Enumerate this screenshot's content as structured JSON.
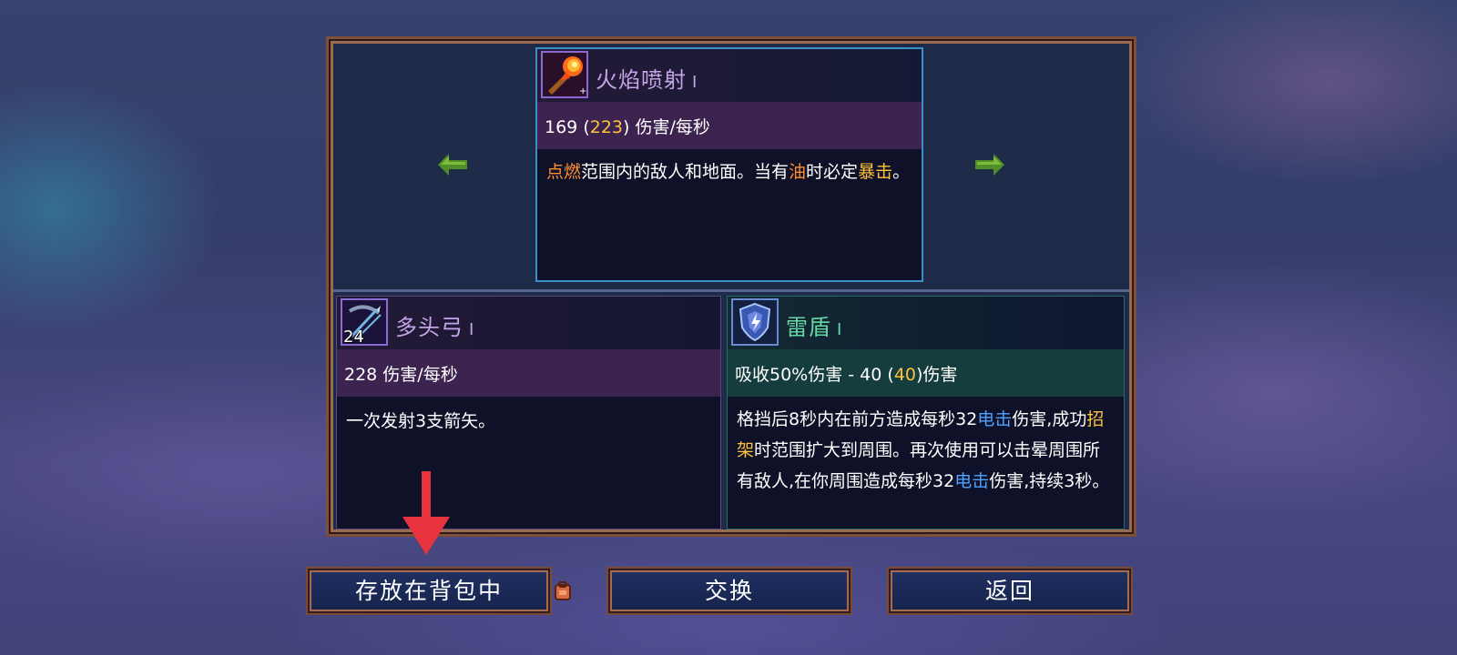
{
  "weapon_top": {
    "name": "火焰喷射",
    "level": "I",
    "stat": {
      "base": "169",
      "open": "(",
      "bonus": "223",
      "close": ")",
      "unit": "伤害/每秒"
    },
    "desc": [
      {
        "t": "点燃",
        "c": "orange"
      },
      {
        "t": "范围内的敌人和地面。当有",
        "c": ""
      },
      {
        "t": "油",
        "c": "orange"
      },
      {
        "t": "时必定",
        "c": ""
      },
      {
        "t": "暴击",
        "c": "gold"
      },
      {
        "t": "。",
        "c": ""
      }
    ],
    "icon": "flamethrower-icon"
  },
  "weapon_left": {
    "name": "多头弓",
    "level": "I",
    "ammo": "24",
    "stat": "228 伤害/每秒",
    "desc": "一次发射3支箭矢。",
    "icon": "multiple-bow-icon"
  },
  "weapon_right": {
    "name": "雷盾",
    "level": "I",
    "stat": {
      "text": "吸收50%伤害 - 40 ",
      "open": "(",
      "bonus": "40",
      "close": ")",
      "unit": "伤害"
    },
    "desc": [
      {
        "t": "格挡后8秒内在前方造成每秒32",
        "c": ""
      },
      {
        "t": "电击",
        "c": "blue"
      },
      {
        "t": "伤害,成功",
        "c": ""
      },
      {
        "t": "招架",
        "c": "gold"
      },
      {
        "t": "时范围扩大到周围。再次使用可以击晕周围所有敌人,在你周围造成每秒32",
        "c": ""
      },
      {
        "t": "电击",
        "c": "blue"
      },
      {
        "t": "伤害,持续3秒。",
        "c": ""
      }
    ],
    "icon": "thunder-shield-icon"
  },
  "buttons": {
    "store": "存放在背包中",
    "swap": "交换",
    "back": "返回"
  },
  "colors": {
    "gold": "#ffc23d",
    "orange": "#ff8d2e",
    "blue": "#4fa2ff",
    "arrow_green": "#4f8f2a",
    "pointer_red": "#e8323e"
  }
}
